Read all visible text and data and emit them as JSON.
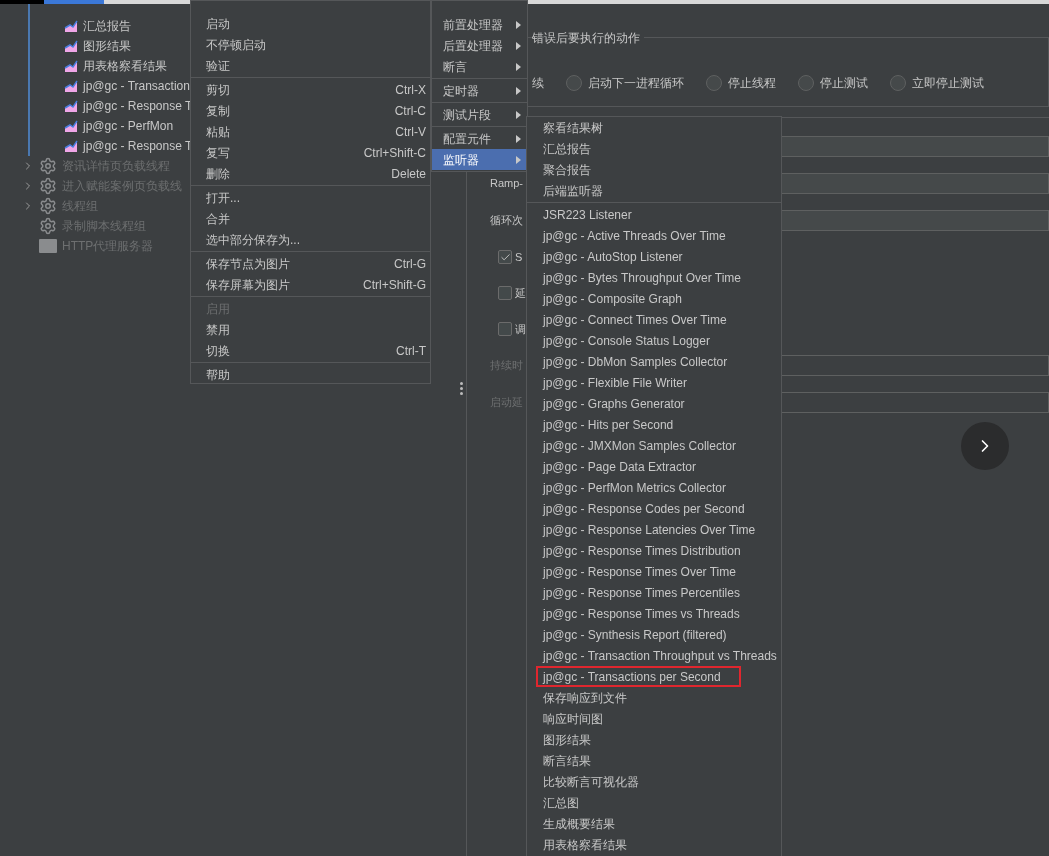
{
  "tree": {
    "items": [
      {
        "label": "汇总报告",
        "kind": "listener",
        "disabled": false,
        "expandable": false
      },
      {
        "label": "图形结果",
        "kind": "listener",
        "disabled": false,
        "expandable": false
      },
      {
        "label": "用表格察看结果",
        "kind": "listener",
        "disabled": false,
        "expandable": false
      },
      {
        "label": "jp@gc - Transaction",
        "kind": "listener",
        "disabled": false,
        "expandable": false
      },
      {
        "label": "jp@gc - Response T",
        "kind": "listener",
        "disabled": false,
        "expandable": false
      },
      {
        "label": "jp@gc - PerfMon",
        "kind": "listener",
        "disabled": false,
        "expandable": false
      },
      {
        "label": "jp@gc - Response T",
        "kind": "listener",
        "disabled": false,
        "expandable": false
      },
      {
        "label": "资讯详情页负载线程",
        "kind": "thread_group",
        "disabled": true,
        "expandable": true
      },
      {
        "label": "进入赋能案例页负载线",
        "kind": "thread_group",
        "disabled": true,
        "expandable": true
      },
      {
        "label": "线程组",
        "kind": "thread_group",
        "disabled": true,
        "expandable": true
      },
      {
        "label": "录制脚本线程组",
        "kind": "thread_group",
        "disabled": true,
        "expandable": false
      },
      {
        "label": "HTTP代理服务器",
        "kind": "proxy",
        "disabled": true,
        "expandable": false
      }
    ]
  },
  "form": {
    "error_action": {
      "legend": "错误后要执行的动作",
      "options": [
        {
          "label": "续",
          "kind": "text"
        },
        {
          "label": "启动下一进程循环",
          "kind": "radio",
          "selected": false
        },
        {
          "label": "停止线程",
          "kind": "radio",
          "selected": false
        },
        {
          "label": "停止测试",
          "kind": "radio",
          "selected": false
        },
        {
          "label": "立即停止测试",
          "kind": "radio",
          "selected": false
        }
      ]
    },
    "rows": [
      {
        "kind": "field",
        "disabled": false
      },
      {
        "kind": "field",
        "label": "Ramp-",
        "disabled": false
      },
      {
        "kind": "field",
        "label": "循环次",
        "disabled": false
      },
      {
        "kind": "checkbox",
        "label": "S",
        "checked": true
      },
      {
        "kind": "checkbox",
        "label": "延",
        "checked": false
      },
      {
        "kind": "checkbox",
        "label": "调",
        "checked": false
      },
      {
        "kind": "field",
        "label": "持续时",
        "disabled": true
      },
      {
        "kind": "field",
        "label": "启动延",
        "disabled": true
      }
    ]
  },
  "context_menu": {
    "groups": [
      [
        {
          "label": "启动",
          "disabled": false
        },
        {
          "label": "不停顿启动",
          "disabled": false
        },
        {
          "label": "验证",
          "disabled": false
        }
      ],
      [
        {
          "label": "剪切",
          "shortcut": "Ctrl-X",
          "disabled": false
        },
        {
          "label": "复制",
          "shortcut": "Ctrl-C",
          "disabled": false
        },
        {
          "label": "粘贴",
          "shortcut": "Ctrl-V",
          "disabled": false
        },
        {
          "label": "复写",
          "shortcut": "Ctrl+Shift-C",
          "disabled": false
        },
        {
          "label": "删除",
          "shortcut": "Delete",
          "disabled": false
        }
      ],
      [
        {
          "label": "打开...",
          "disabled": false
        },
        {
          "label": "合并",
          "disabled": false
        },
        {
          "label": "选中部分保存为...",
          "disabled": false
        }
      ],
      [
        {
          "label": "保存节点为图片",
          "shortcut": "Ctrl-G",
          "disabled": false
        },
        {
          "label": "保存屏幕为图片",
          "shortcut": "Ctrl+Shift-G",
          "disabled": false
        }
      ],
      [
        {
          "label": "启用",
          "disabled": true
        },
        {
          "label": "禁用",
          "disabled": false
        },
        {
          "label": "切换",
          "shortcut": "Ctrl-T",
          "disabled": false
        }
      ],
      [
        {
          "label": "帮助",
          "disabled": false
        }
      ]
    ]
  },
  "add_submenu": {
    "groups": [
      [
        {
          "label": "前置处理器",
          "selected": false
        },
        {
          "label": "后置处理器",
          "selected": false
        },
        {
          "label": "断言",
          "selected": false
        }
      ],
      [
        {
          "label": "定时器",
          "selected": false
        }
      ],
      [
        {
          "label": "测试片段",
          "selected": false
        }
      ],
      [
        {
          "label": "配置元件",
          "selected": false
        },
        {
          "label": "监听器",
          "selected": true
        }
      ]
    ]
  },
  "listener_menu": {
    "groups": [
      [
        {
          "label": "察看结果树",
          "outlined": false
        },
        {
          "label": "汇总报告",
          "outlined": false
        },
        {
          "label": "聚合报告",
          "outlined": false
        },
        {
          "label": "后端监听器",
          "outlined": false
        }
      ],
      [
        {
          "label": "JSR223 Listener",
          "outlined": false
        },
        {
          "label": "jp@gc - Active Threads Over Time",
          "outlined": false
        },
        {
          "label": "jp@gc - AutoStop Listener",
          "outlined": false
        },
        {
          "label": "jp@gc - Bytes Throughput Over Time",
          "outlined": false
        },
        {
          "label": "jp@gc - Composite Graph",
          "outlined": false
        },
        {
          "label": "jp@gc - Connect Times Over Time",
          "outlined": false
        },
        {
          "label": "jp@gc - Console Status Logger",
          "outlined": false
        },
        {
          "label": "jp@gc - DbMon Samples Collector",
          "outlined": false
        },
        {
          "label": "jp@gc - Flexible File Writer",
          "outlined": false
        },
        {
          "label": "jp@gc - Graphs Generator",
          "outlined": false
        },
        {
          "label": "jp@gc - Hits per Second",
          "outlined": false
        },
        {
          "label": "jp@gc - JMXMon Samples Collector",
          "outlined": false
        },
        {
          "label": "jp@gc - Page Data Extractor",
          "outlined": false
        },
        {
          "label": "jp@gc - PerfMon Metrics Collector",
          "outlined": false
        },
        {
          "label": "jp@gc - Response Codes per Second",
          "outlined": false
        },
        {
          "label": "jp@gc - Response Latencies Over Time",
          "outlined": false
        },
        {
          "label": "jp@gc - Response Times Distribution",
          "outlined": false
        },
        {
          "label": "jp@gc - Response Times Over Time",
          "outlined": false
        },
        {
          "label": "jp@gc - Response Times Percentiles",
          "outlined": false
        },
        {
          "label": "jp@gc - Response Times vs Threads",
          "outlined": false
        },
        {
          "label": "jp@gc - Synthesis Report (filtered)",
          "outlined": false
        },
        {
          "label": "jp@gc - Transaction Throughput vs Threads",
          "outlined": false
        },
        {
          "label": "jp@gc - Transactions per Second",
          "outlined": true
        },
        {
          "label": "保存响应到文件",
          "outlined": false
        },
        {
          "label": "响应时间图",
          "outlined": false
        },
        {
          "label": "图形结果",
          "outlined": false
        },
        {
          "label": "断言结果",
          "outlined": false
        },
        {
          "label": "比较断言可视化器",
          "outlined": false
        },
        {
          "label": "汇总图",
          "outlined": false
        },
        {
          "label": "生成概要结果",
          "outlined": false
        },
        {
          "label": "用表格察看结果",
          "outlined": false
        }
      ]
    ]
  }
}
